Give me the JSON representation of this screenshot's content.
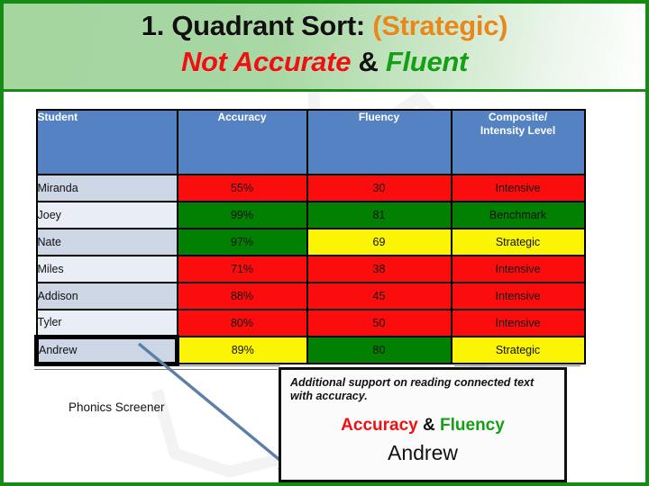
{
  "title": {
    "line1_prefix": "1. Quadrant Sort: ",
    "line1_strategic": "(Strategic)",
    "line2_not": "Not ",
    "line2_accurate": "Accurate",
    "line2_amp": " & ",
    "line2_fluent": "Fluent"
  },
  "table": {
    "headers": {
      "student": "Student",
      "accuracy": "Accuracy",
      "fluency": "Fluency",
      "composite_line1": "Composite/",
      "composite_line2": "Intensity Level"
    },
    "rows": [
      {
        "student": "Miranda",
        "accuracy": "55%",
        "accuracy_color": "red",
        "fluency": "30",
        "fluency_color": "red",
        "level": "Intensive",
        "level_color": "red"
      },
      {
        "student": "Joey",
        "accuracy": "99%",
        "accuracy_color": "green",
        "fluency": "81",
        "fluency_color": "green",
        "level": "Benchmark",
        "level_color": "green"
      },
      {
        "student": "Nate",
        "accuracy": "97%",
        "accuracy_color": "green",
        "fluency": "69",
        "fluency_color": "yellow",
        "level": "Strategic",
        "level_color": "yellow"
      },
      {
        "student": "Miles",
        "accuracy": "71%",
        "accuracy_color": "red",
        "fluency": "38",
        "fluency_color": "red",
        "level": "Intensive",
        "level_color": "red"
      },
      {
        "student": "Addison",
        "accuracy": "88%",
        "accuracy_color": "red",
        "fluency": "45",
        "fluency_color": "red",
        "level": "Intensive",
        "level_color": "red"
      },
      {
        "student": "Tyler",
        "accuracy": "80%",
        "accuracy_color": "red",
        "fluency": "50",
        "fluency_color": "red",
        "level": "Intensive",
        "level_color": "red"
      },
      {
        "student": "Andrew",
        "accuracy": "89%",
        "accuracy_color": "yellow",
        "fluency": "80",
        "fluency_color": "green",
        "level": "Strategic",
        "level_color": "yellow"
      }
    ]
  },
  "phonics_label": "Phonics Screener",
  "callout": {
    "note": "Additional support on reading connected text with accuracy.",
    "heading_accuracy": "Accuracy",
    "heading_amp": " & ",
    "heading_fluency": "Fluency",
    "name": "Andrew"
  },
  "colors": {
    "header_blue": "#5482c2",
    "red": "#fc0d0d",
    "green": "#028002",
    "yellow": "#fbf505",
    "row_shade_a": "#ccd6e4",
    "row_shade_b": "#e9eef6",
    "slide_border_green": "#148c14",
    "arrow_blue": "#5b7fa6",
    "title_orange": "#e8871a"
  }
}
